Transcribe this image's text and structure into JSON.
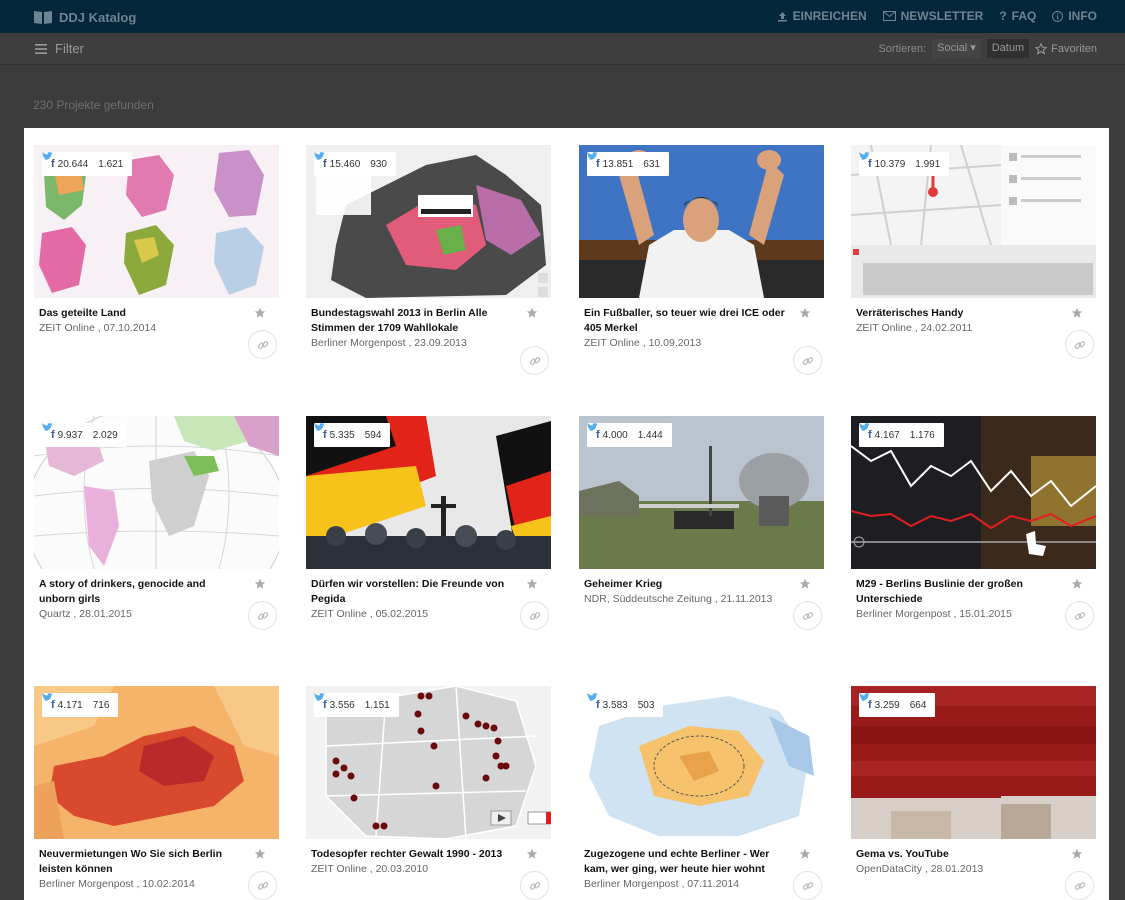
{
  "header": {
    "brand": "DDJ Katalog",
    "nav": [
      {
        "label": "EINREICHEN",
        "icon": "upload-icon"
      },
      {
        "label": "NEWSLETTER",
        "icon": "mail-icon"
      },
      {
        "label": "FAQ",
        "icon": "question-icon"
      },
      {
        "label": "INFO",
        "icon": "info-icon"
      }
    ]
  },
  "filterbar": {
    "filter_label": "Filter",
    "sort_label": "Sortieren:",
    "sort_social": "Social",
    "sort_date": "Datum",
    "favorites": "Favoriten"
  },
  "results_count": "230 Projekte gefunden",
  "colors": {
    "accent": "#04263a",
    "facebook": "#3b5998",
    "twitter": "#55acee"
  },
  "projects": [
    {
      "title": "Das geteilte Land",
      "source": "ZEIT Online , 07.10.2014",
      "facebook": "20.644",
      "twitter": "1.621"
    },
    {
      "title": "Bundestagswahl 2013 in Berlin Alle Stimmen der 1709 Wahllokale",
      "source": "Berliner Morgenpost , 23.09.2013",
      "facebook": "15.460",
      "twitter": "930"
    },
    {
      "title": "Ein Fußballer, so teuer wie drei ICE oder 405 Merkel",
      "source": "ZEIT Online , 10.09.2013",
      "facebook": "13.851",
      "twitter": "631"
    },
    {
      "title": "Verräterisches Handy",
      "source": "ZEIT Online , 24.02.2011",
      "facebook": "10.379",
      "twitter": "1.991"
    },
    {
      "title": "A story of drinkers, genocide and unborn girls",
      "source": "Quartz , 28.01.2015",
      "facebook": "9.937",
      "twitter": "2.029"
    },
    {
      "title": "Dürfen wir vorstellen: Die Freunde von Pegida",
      "source": "ZEIT Online , 05.02.2015",
      "facebook": "5.335",
      "twitter": "594"
    },
    {
      "title": "Geheimer Krieg",
      "source": "NDR, Süddeutsche Zeitung , 21.11.2013",
      "facebook": "4.000",
      "twitter": "1.444"
    },
    {
      "title": "M29 - Berlins Buslinie der großen Unterschiede",
      "source": "Berliner Morgenpost , 15.01.2015",
      "facebook": "4.167",
      "twitter": "1.176"
    },
    {
      "title": "Neuvermietungen Wo Sie sich Berlin leisten können",
      "source": "Berliner Morgenpost , 10.02.2014",
      "facebook": "4.171",
      "twitter": "716"
    },
    {
      "title": "Todesopfer rechter Gewalt 1990 - 2013",
      "source": "ZEIT Online , 20.03.2010",
      "facebook": "3.556",
      "twitter": "1.151"
    },
    {
      "title": "Zugezogene und echte Berliner - Wer kam, wer ging, wer heute hier wohnt",
      "source": "Berliner Morgenpost , 07.11.2014",
      "facebook": "3.583",
      "twitter": "503"
    },
    {
      "title": "Gema vs. YouTube",
      "source": "OpenDataCity , 28.01.2013",
      "facebook": "3.259",
      "twitter": "664"
    }
  ]
}
